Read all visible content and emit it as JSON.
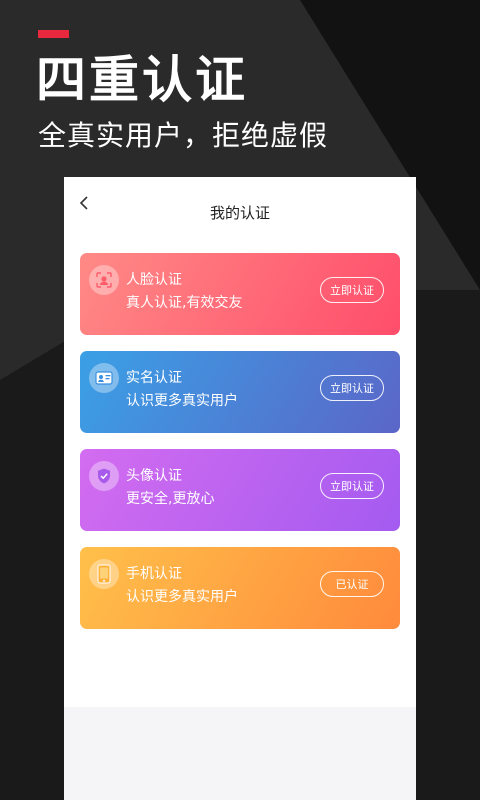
{
  "hero": {
    "title": "四重认证",
    "subtitle": "全真实用户，拒绝虚假",
    "accent": "#e8283c"
  },
  "screen": {
    "nav": {
      "title": "我的认证",
      "back_icon": "chevron-left-icon"
    },
    "cards": [
      {
        "title": "人脸认证",
        "description": "真人认证,有效交友",
        "button": "立即认证",
        "icon": "face-scan-icon",
        "gradient": [
          "#ff8a86",
          "#ff4d6b"
        ]
      },
      {
        "title": "实名认证",
        "description": "认识更多真实用户",
        "button": "立即认证",
        "icon": "id-card-icon",
        "gradient": [
          "#3aa0e6",
          "#5b66c8"
        ]
      },
      {
        "title": "头像认证",
        "description": "更安全,更放心",
        "button": "立即认证",
        "icon": "shield-check-icon",
        "gradient": [
          "#d36cf0",
          "#a45bf0"
        ]
      },
      {
        "title": "手机认证",
        "description": "认识更多真实用户",
        "button": "已认证",
        "icon": "phone-icon",
        "gradient": [
          "#ffc04a",
          "#ff8a3c"
        ]
      }
    ]
  }
}
